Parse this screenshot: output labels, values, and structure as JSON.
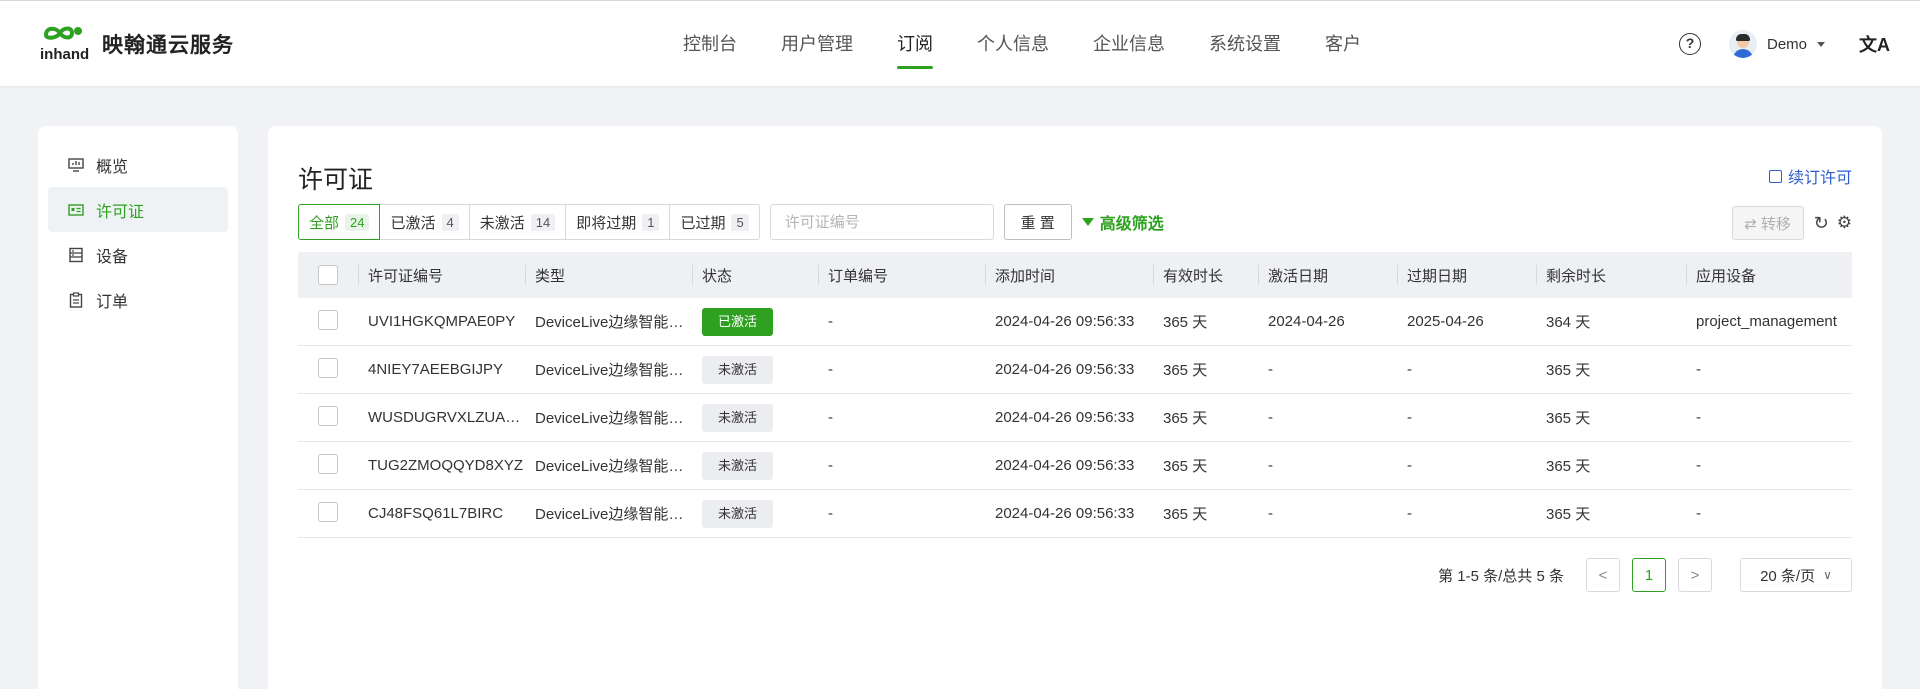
{
  "brand": {
    "name": "映翰通云服务",
    "mark_text": "inhand",
    "accent": "#2ea121"
  },
  "nav": [
    {
      "label": "控制台"
    },
    {
      "label": "用户管理"
    },
    {
      "label": "订阅",
      "active": true
    },
    {
      "label": "个人信息"
    },
    {
      "label": "企业信息"
    },
    {
      "label": "系统设置"
    },
    {
      "label": "客户"
    }
  ],
  "header": {
    "user_name": "Demo",
    "help_icon": "?",
    "lang_icon": "文A"
  },
  "sidebar": {
    "items": [
      {
        "label": "概览",
        "icon": "monitor-icon"
      },
      {
        "label": "许可证",
        "icon": "license-icon",
        "active": true
      },
      {
        "label": "设备",
        "icon": "device-icon"
      },
      {
        "label": "订单",
        "icon": "clipboard-icon"
      }
    ]
  },
  "page": {
    "title": "许可证",
    "renew_label": "续订许可"
  },
  "filters": {
    "segments": [
      {
        "label": "全部",
        "count": "24",
        "active": true
      },
      {
        "label": "已激活",
        "count": "4"
      },
      {
        "label": "未激活",
        "count": "14"
      },
      {
        "label": "即将过期",
        "count": "1"
      },
      {
        "label": "已过期",
        "count": "5"
      }
    ],
    "search_placeholder": "许可证编号",
    "reset_label": "重 置",
    "advanced_label": "高级筛选"
  },
  "toolbar": {
    "transfer_label": "⇄ 转移"
  },
  "table": {
    "columns": [
      "许可证编号",
      "类型",
      "状态",
      "订单编号",
      "添加时间",
      "有效时长",
      "激活日期",
      "过期日期",
      "剩余时长",
      "应用设备"
    ],
    "rows": [
      {
        "id": "UVI1HGKQMPAE0PY",
        "type": "DeviceLive边缘智能网关",
        "status": "已激活",
        "active": true,
        "order": "-",
        "added": "2024-04-26 09:56:33",
        "duration": "365 天",
        "activated": "2024-04-26",
        "expires": "2025-04-26",
        "remaining": "364 天",
        "device": "project_management"
      },
      {
        "id": "4NIEY7AEEBGIJPY",
        "type": "DeviceLive边缘智能网关",
        "status": "未激活",
        "active": false,
        "order": "-",
        "added": "2024-04-26 09:56:33",
        "duration": "365 天",
        "activated": "-",
        "expires": "-",
        "remaining": "365 天",
        "device": "-"
      },
      {
        "id": "WUSDUGRVXLZUABC",
        "type": "DeviceLive边缘智能网关",
        "status": "未激活",
        "active": false,
        "order": "-",
        "added": "2024-04-26 09:56:33",
        "duration": "365 天",
        "activated": "-",
        "expires": "-",
        "remaining": "365 天",
        "device": "-"
      },
      {
        "id": "TUG2ZMOQQYD8XYZ",
        "type": "DeviceLive边缘智能网关",
        "status": "未激活",
        "active": false,
        "order": "-",
        "added": "2024-04-26 09:56:33",
        "duration": "365 天",
        "activated": "-",
        "expires": "-",
        "remaining": "365 天",
        "device": "-"
      },
      {
        "id": "CJ48FSQ61L7BIRC",
        "type": "DeviceLive边缘智能网关",
        "status": "未激活",
        "active": false,
        "order": "-",
        "added": "2024-04-26 09:56:33",
        "duration": "365 天",
        "activated": "-",
        "expires": "-",
        "remaining": "365 天",
        "device": "-"
      }
    ]
  },
  "pagination": {
    "total_text": "第 1-5 条/总共 5 条",
    "current_page": "1",
    "prev": "<",
    "next": ">",
    "page_size": "20 条/页"
  }
}
